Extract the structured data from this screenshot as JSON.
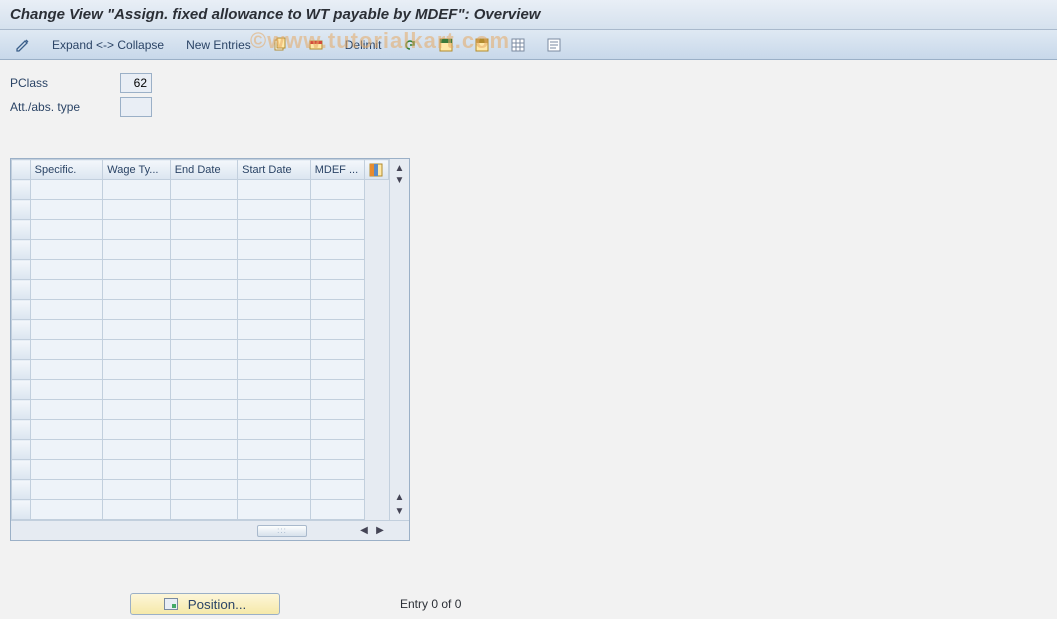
{
  "title": "Change View \"Assign. fixed allowance to WT payable by MDEF\": Overview",
  "toolbar": {
    "expand_collapse": "Expand <-> Collapse",
    "new_entries": "New Entries",
    "delimit": "Delimit"
  },
  "fields": {
    "pclass_label": "PClass",
    "pclass_value": "62",
    "att_abs_label": "Att./abs. type",
    "att_abs_value": ""
  },
  "table": {
    "columns": [
      "Specific.",
      "Wage Ty...",
      "End Date",
      "Start Date",
      "MDEF ..."
    ],
    "rows": 18
  },
  "footer": {
    "position_label": "Position...",
    "entry_status": "Entry 0 of 0"
  },
  "watermark": "©www.tutorialkart.com"
}
